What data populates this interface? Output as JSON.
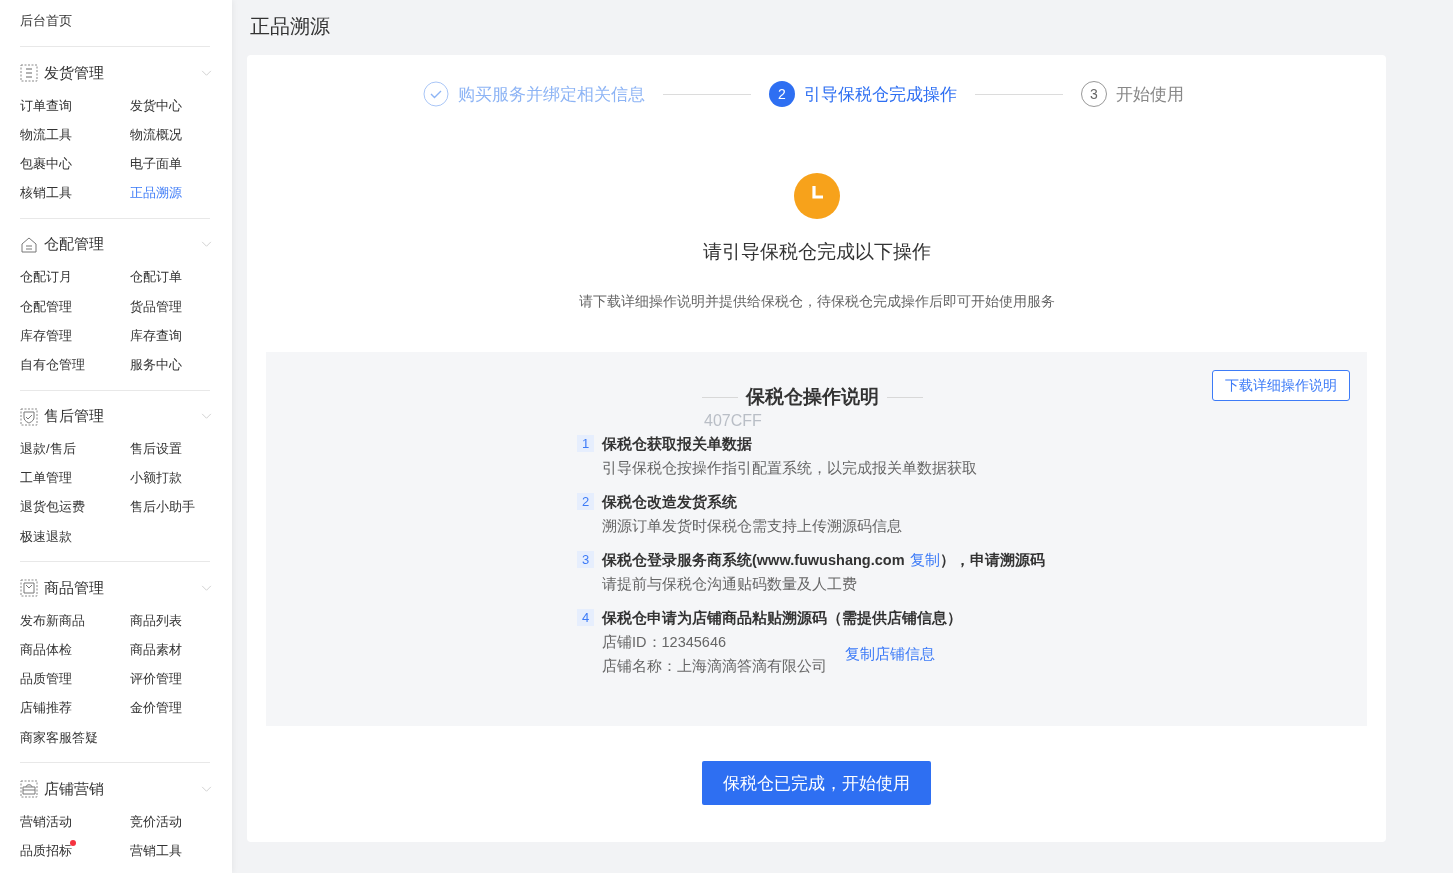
{
  "sidebar": {
    "home": {
      "label": "后台首页"
    },
    "sections": [
      {
        "title": "发货管理",
        "expanded": true,
        "items": [
          {
            "label": "订单查询",
            "selected": false
          },
          {
            "label": "发货中心",
            "selected": false
          },
          {
            "label": "物流工具",
            "selected": false
          },
          {
            "label": "物流概况",
            "selected": false
          },
          {
            "label": "包裹中心",
            "selected": false
          },
          {
            "label": "电子面单",
            "selected": false
          },
          {
            "label": "核销工具",
            "selected": false
          },
          {
            "label": "正品溯源",
            "selected": true
          }
        ]
      },
      {
        "title": "仓配管理",
        "expanded": true,
        "items": [
          {
            "label": "仓配订月",
            "selected": false
          },
          {
            "label": "仓配订单",
            "selected": false
          },
          {
            "label": "仓配管理",
            "selected": false
          },
          {
            "label": "货品管理",
            "selected": false
          },
          {
            "label": "库存管理",
            "selected": false
          },
          {
            "label": "库存查询",
            "selected": false
          },
          {
            "label": "自有仓管理",
            "selected": false
          },
          {
            "label": "服务中心",
            "selected": false
          }
        ]
      },
      {
        "title": "售后管理",
        "expanded": true,
        "items": [
          {
            "label": "退款/售后",
            "selected": false
          },
          {
            "label": "售后设置",
            "selected": false
          },
          {
            "label": "工单管理",
            "selected": false
          },
          {
            "label": "小额打款",
            "selected": false
          },
          {
            "label": "退货包运费",
            "selected": false
          },
          {
            "label": "售后小助手",
            "selected": false
          },
          {
            "label": "极速退款",
            "selected": false
          }
        ]
      },
      {
        "title": "商品管理",
        "expanded": true,
        "items": [
          {
            "label": "发布新商品",
            "selected": false
          },
          {
            "label": "商品列表",
            "selected": false
          },
          {
            "label": "商品体检",
            "selected": false
          },
          {
            "label": "商品素材",
            "selected": false
          },
          {
            "label": "品质管理",
            "selected": false
          },
          {
            "label": "评价管理",
            "selected": false
          },
          {
            "label": "店铺推荐",
            "selected": false
          },
          {
            "label": "金价管理",
            "selected": false
          },
          {
            "label": "商家客服答疑",
            "selected": false
          }
        ]
      },
      {
        "title": "店铺营销",
        "expanded": true,
        "items": [
          {
            "label": "营销活动",
            "selected": false
          },
          {
            "label": "竞价活动",
            "selected": false
          },
          {
            "label": "品质招标",
            "selected": false,
            "dot": true
          },
          {
            "label": "营销工具",
            "selected": false
          }
        ]
      }
    ]
  },
  "page_title": "正品溯源",
  "steps": [
    {
      "done": true,
      "selected": false,
      "label": "购买服务并绑定相关信息"
    },
    {
      "done": false,
      "selected": true,
      "number": "2",
      "label": "引导保税仓完成操作"
    },
    {
      "done": false,
      "selected": false,
      "number": "3",
      "label": "开始使用"
    }
  ],
  "notice": {
    "heading": "请引导保税仓完成以下操作",
    "message": "请下载详细操作说明并提供给保税仓，待保税仓完成操作后即可开始使用服务"
  },
  "guide": {
    "title": "保税仓操作说明",
    "download_button": "下载详细操作说明",
    "faint_text": "407CFF",
    "items": [
      {
        "index": "1",
        "title": "保税仓获取报关单数据",
        "lines": [
          "引导保税仓按操作指引配置系统，以完成报关单数据获取"
        ]
      },
      {
        "index": "2",
        "title": "保税仓改造发货系统",
        "lines": [
          "溯源订单发货时保税仓需支持上传溯源码信息"
        ]
      },
      {
        "index": "3",
        "title": "保税仓登录服务商系统(www.fuwushang.com",
        "title_link": "复制",
        "title_after": "），申请溯源码",
        "lines": [
          "请提前与保税仓沟通贴码数量及人工费"
        ]
      },
      {
        "index": "4",
        "title": "保税仓申请为店铺商品粘贴溯源码（需提供店铺信息）",
        "lines": [
          "店铺ID：12345646",
          "店铺名称：上海滴滴答滴有限公司"
        ],
        "side_link": "复制店铺信息"
      }
    ]
  },
  "primary_button": "保税仓已完成，开始使用"
}
